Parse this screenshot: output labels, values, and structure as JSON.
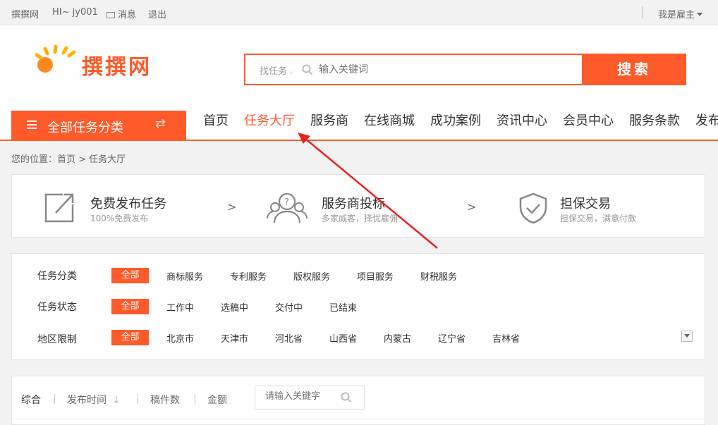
{
  "topbar": {
    "site": "撰撰网",
    "greeting": "HI~ jy001",
    "messages": "消息",
    "logout": "退出",
    "role": "我是雇主"
  },
  "logo": {
    "text": "撰撰网"
  },
  "search": {
    "type": "找任务",
    "placeholder": "输入关键词",
    "button": "搜索"
  },
  "category": {
    "label": "全部任务分类"
  },
  "nav": [
    "首页",
    "任务大厅",
    "服务商",
    "在线商城",
    "成功案例",
    "资讯中心",
    "会员中心",
    "服务条款",
    "发布"
  ],
  "nav_active": "任务大厅",
  "breadcrumb": "您的位置：首页 > 任务大厅",
  "steps": [
    {
      "title": "免费发布任务",
      "sub": "100%免费发布"
    },
    {
      "title": "服务商投标",
      "sub": "多家威客，择优雇佣"
    },
    {
      "title": "担保交易",
      "sub": "担保交易，满意付款"
    }
  ],
  "filters": [
    {
      "label": "任务分类",
      "all": "全部",
      "options": [
        "商标服务",
        "专利服务",
        "版权服务",
        "项目服务",
        "财税服务"
      ]
    },
    {
      "label": "任务状态",
      "all": "全部",
      "options": [
        "工作中",
        "选稿中",
        "交付中",
        "已结束"
      ]
    },
    {
      "label": "地区限制",
      "all": "全部",
      "options": [
        "北京市",
        "天津市",
        "河北省",
        "山西省",
        "内蒙古",
        "辽宁省",
        "吉林省"
      ]
    }
  ],
  "sort": {
    "items": [
      "综合",
      "发布时间",
      "稿件数",
      "金额"
    ],
    "keyword_placeholder": "请输入关键字"
  },
  "colors": {
    "accent": "#ff5a2a",
    "annotation": "#e8231f"
  }
}
